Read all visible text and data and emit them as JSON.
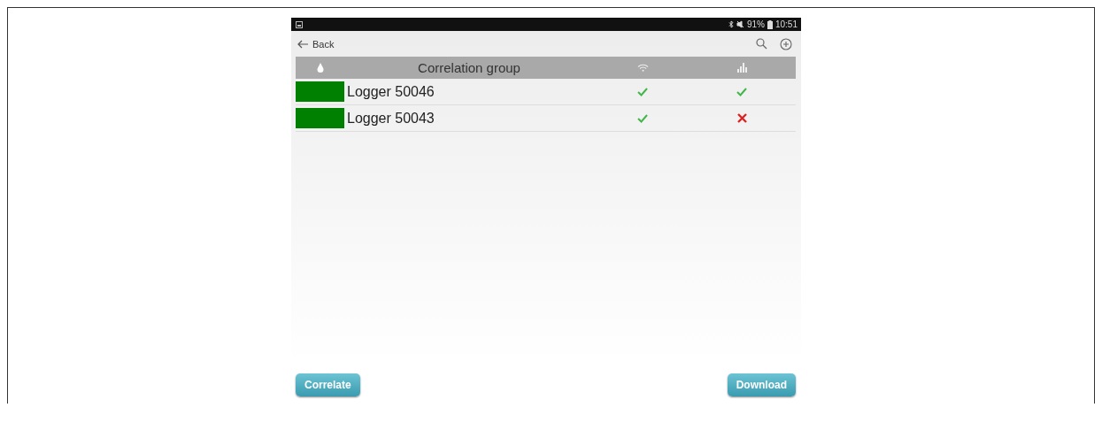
{
  "status_bar": {
    "battery": "91%",
    "time": "10:51"
  },
  "nav": {
    "back": "Back"
  },
  "header": {
    "title": "Correlation group"
  },
  "loggers": [
    {
      "name": "Logger 50046",
      "color": "#008000",
      "connected": true,
      "downloaded": true
    },
    {
      "name": "Logger 50043",
      "color": "#008000",
      "connected": true,
      "downloaded": false
    }
  ],
  "buttons": [
    "Correlate",
    "Download"
  ]
}
